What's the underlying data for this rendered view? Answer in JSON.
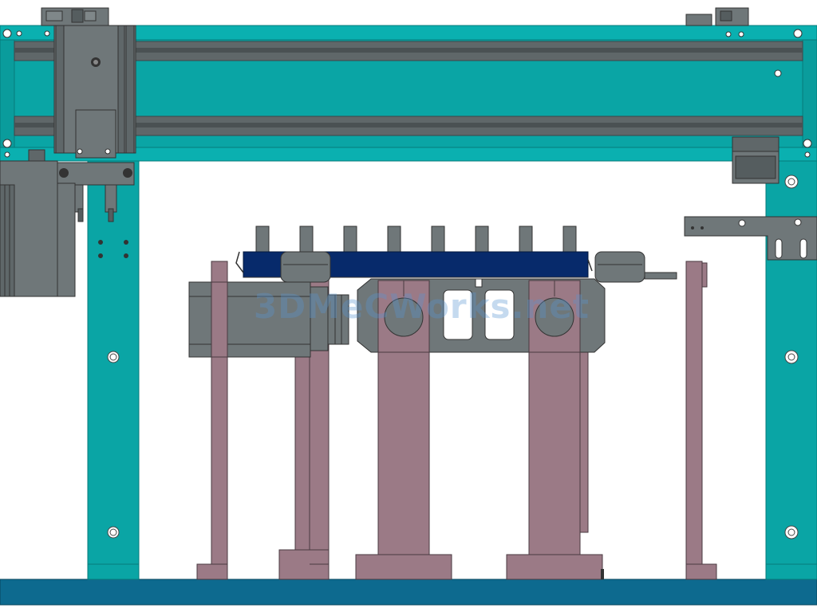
{
  "colors": {
    "frame_teal": "#0aa5a5",
    "frame_teal_dark": "#088a8a",
    "rail_gray": "#5f6769",
    "rail_dark": "#3e4446",
    "part_gray": "#6f7779",
    "support_mauve": "#9b7a86",
    "support_dark": "#7d5f6b",
    "conveyor_navy": "#072a6b",
    "base_blue": "#0d6a8f",
    "background": "#ffffff"
  },
  "watermark": {
    "text": "3DMeCWorks.net"
  },
  "icons": {
    "bolt": "bolt-icon",
    "hole": "mount-hole-icon"
  },
  "pins_count": 8
}
